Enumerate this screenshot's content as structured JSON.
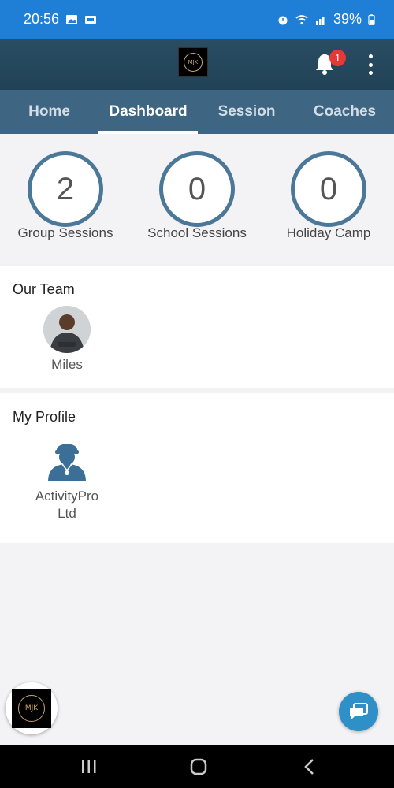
{
  "status_bar": {
    "time": "20:56",
    "battery": "39%",
    "left_icons": [
      "image-icon",
      "screen-share-icon"
    ],
    "right_icons": [
      "alarm-icon",
      "wifi-icon",
      "signal-icon",
      "battery-icon"
    ]
  },
  "header": {
    "logo_text": "MJK",
    "notification_count": "1",
    "colors": {
      "header": "#2a4d64",
      "tabs": "#3e6581",
      "status_bar": "#1f7fd6",
      "badge": "#e53935"
    }
  },
  "tabs": [
    {
      "label": "Home",
      "active": false
    },
    {
      "label": "Dashboard",
      "active": true
    },
    {
      "label": "Session",
      "active": false
    },
    {
      "label": "Coaches",
      "active": false
    }
  ],
  "stats": [
    {
      "value": "2",
      "label": "Group Sessions"
    },
    {
      "value": "0",
      "label": "School Sessions"
    },
    {
      "value": "0",
      "label": "Holiday Camp"
    }
  ],
  "team": {
    "title": "Our Team",
    "members": [
      {
        "name": "Miles"
      }
    ]
  },
  "profile": {
    "title": "My Profile",
    "name_line1": "ActivityPro",
    "name_line2": "Ltd"
  },
  "fab": {
    "logo_text": "MJK",
    "chat_icon": "chat-icon"
  },
  "nav_bar": {
    "buttons": [
      "recent-apps-icon",
      "home-icon",
      "back-icon"
    ]
  }
}
